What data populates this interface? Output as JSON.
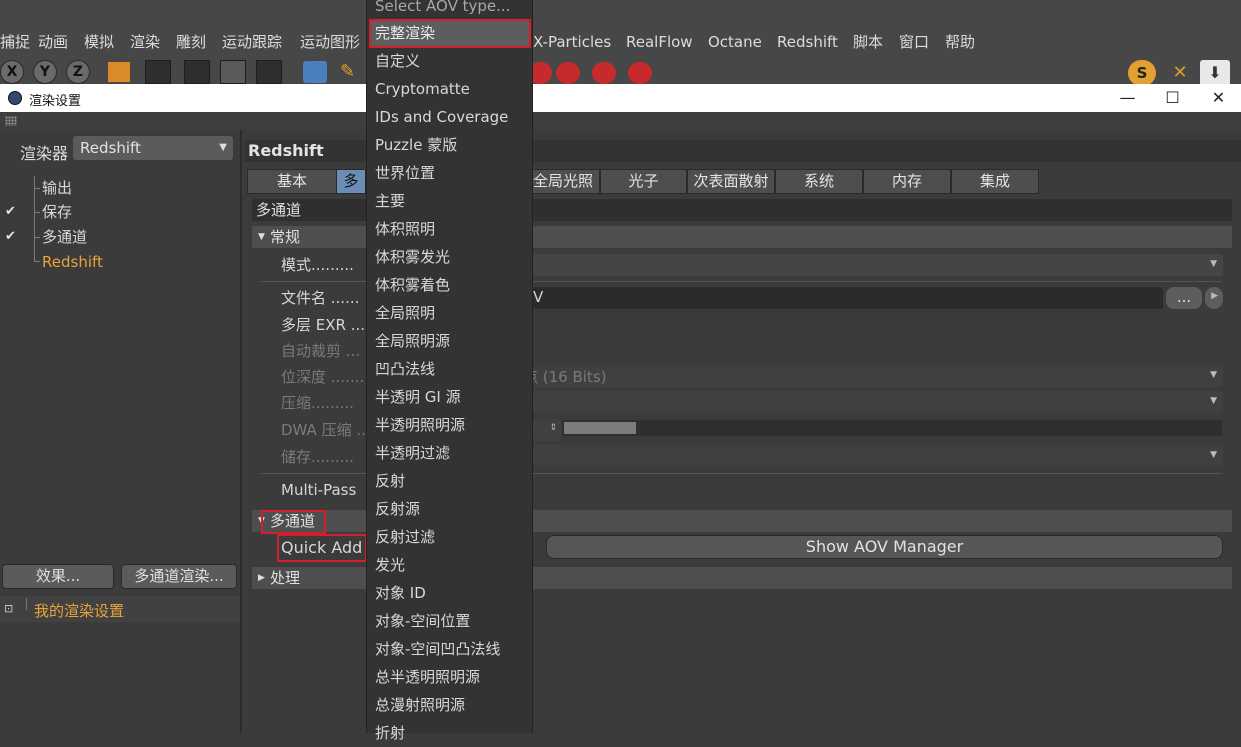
{
  "main_menu": [
    "捕捉",
    "动画",
    "模拟",
    "渲染",
    "雕刻",
    "运动跟踪",
    "运动图形",
    "X-Particles",
    "RealFlow",
    "Octane",
    "Redshift",
    "脚本",
    "窗口",
    "帮助"
  ],
  "toolbar": {
    "axis_labels": [
      "X",
      "Y",
      "Z"
    ]
  },
  "window": {
    "title": "渲染设置",
    "min_symbol": "—",
    "max_symbol": "☐",
    "close_symbol": "✕"
  },
  "left_panel": {
    "renderer_label": "渲染器",
    "renderer_value": "Redshift",
    "tree": [
      {
        "label": "输出",
        "checked": false
      },
      {
        "label": "保存",
        "checked": true
      },
      {
        "label": "多通道",
        "checked": true
      },
      {
        "label": "Redshift",
        "checked": false
      }
    ],
    "check_mark": "✔",
    "effects_button": "效果...",
    "multipass_button": "多通道渲染...",
    "preset_name": "我的渲染设置"
  },
  "right_panel": {
    "header": "Redshift",
    "tabs": [
      "基本",
      "多",
      "全局光照",
      "光子",
      "次表面散射",
      "系统",
      "内存",
      "集成"
    ],
    "section_title": "多通道",
    "general_group": "常规",
    "props": {
      "mode": "模式.........",
      "filename": "文件名 ......",
      "multilayer_exr": "多层 EXR ...",
      "autocrop": "自动裁剪 ...",
      "bitdepth": "位深度 .......",
      "compression": "压缩.........",
      "dwa": "DWA 压缩 ...",
      "storage": "储存.........",
      "multipass": "Multi-Pass"
    },
    "filename_value": "V",
    "browse_button": "...",
    "bitdepth_value": "点 (16 Bits)",
    "multipass_group": "多通道",
    "quick_add": "Quick Add",
    "show_aov_manager": "Show AOV Manager",
    "process_group": "处理"
  },
  "dropdown": {
    "header": "Select AOV type...",
    "selected": "完整渲染",
    "items": [
      "完整渲染",
      "自定义",
      "Cryptomatte",
      "IDs and Coverage",
      "Puzzle 蒙版",
      "世界位置",
      "主要",
      "体积照明",
      "体积雾发光",
      "体积雾着色",
      "全局照明",
      "全局照明源",
      "凹凸法线",
      "半透明 GI 源",
      "半透明照明源",
      "半透明过滤",
      "反射",
      "反射源",
      "反射过滤",
      "发光",
      "对象 ID",
      "对象-空间位置",
      "对象-空间凹凸法线",
      "总半透明照明源",
      "总漫射照明源",
      "折射"
    ]
  },
  "colors": {
    "accent_orange": "#e8a43c",
    "highlight_red": "#d21f2b",
    "active_tab": "#6b8cb3"
  }
}
